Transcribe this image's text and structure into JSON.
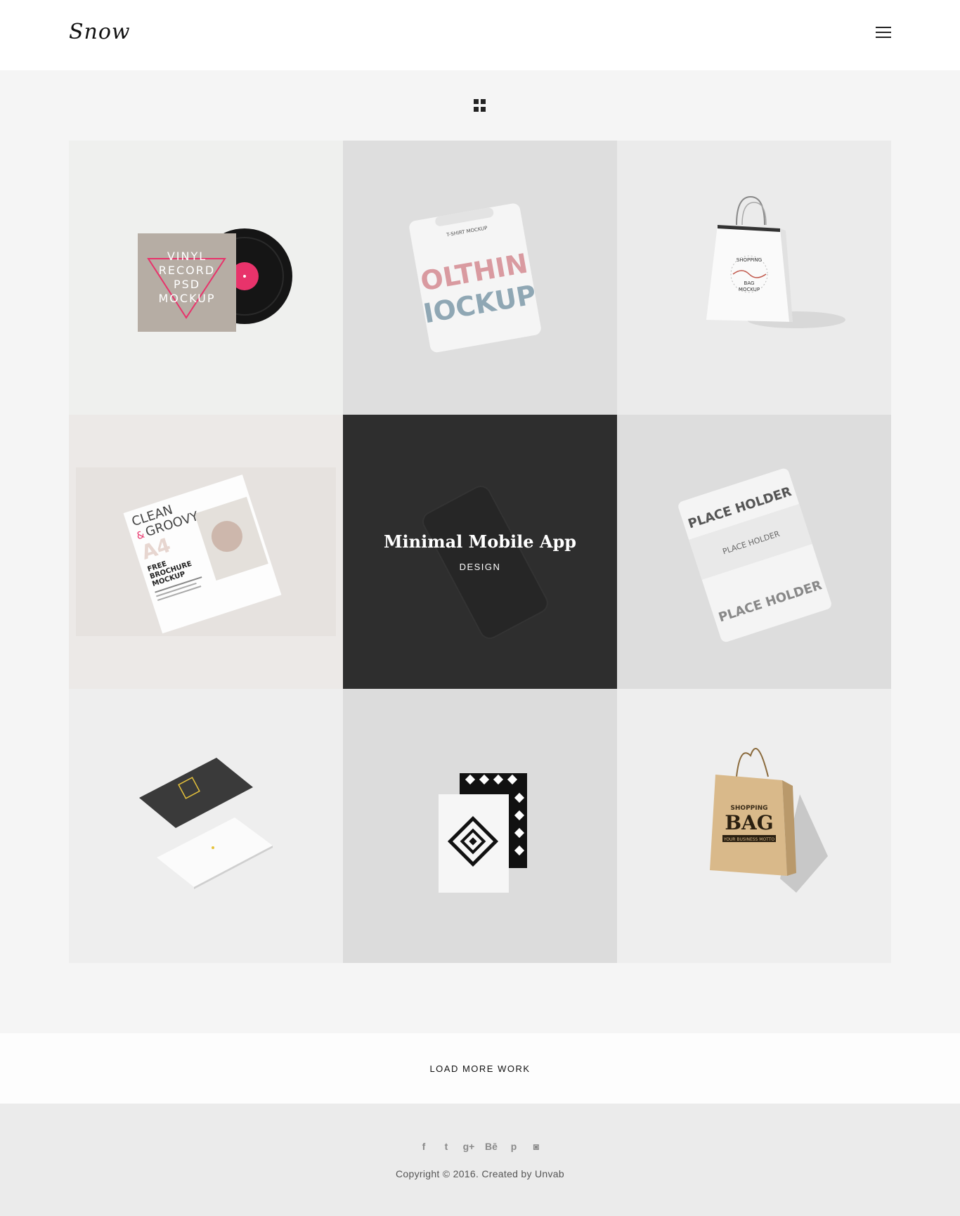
{
  "header": {
    "logo": "Snow",
    "menu_icon": "hamburger-menu-icon"
  },
  "filter": {
    "icon": "grid-filter-icon"
  },
  "colors": {
    "dark_overlay": "#2e2e2e",
    "background": "#f5f5f5",
    "footer_bg": "#ebebeb",
    "accent_pink": "#e8336b"
  },
  "portfolio": {
    "items": [
      {
        "image": "vinyl-record-mockup",
        "bg": "#eff0ee",
        "print": [
          "VINYL",
          "RECORD",
          "PSD",
          "MOCKUP"
        ]
      },
      {
        "image": "tshirt-mockup",
        "bg": "#dedede",
        "print": [
          "OLTHIN",
          "IOCKUP",
          "T-SHIRT MOCKUP"
        ]
      },
      {
        "image": "shopping-bag-white-mockup",
        "bg": "#ebebeb",
        "print": [
          "SHOPPING",
          "BAG",
          "MOCKUP"
        ]
      },
      {
        "image": "brochure-mockup",
        "bg": "#ece9e7",
        "print": [
          "CLEAN",
          "&",
          "GROOVY",
          "A4",
          "FREE",
          "BROCHURE",
          "MOCKUP"
        ]
      },
      {
        "image": "phone-mockup",
        "bg": "#2e2e2e",
        "title": "Minimal Mobile App",
        "category": "DESIGN"
      },
      {
        "image": "tshirt-placeholder-mockup",
        "bg": "#dddddd",
        "print": [
          "PLACE HOLDER",
          "PLACE HOLDER",
          "PLACE HOLDER"
        ]
      },
      {
        "image": "business-card-mockup",
        "bg": "#eeeeee"
      },
      {
        "image": "stationery-pattern-mockup",
        "bg": "#dcdcdc"
      },
      {
        "image": "kraft-bag-mockup",
        "bg": "#eeeeee",
        "print": [
          "SHOPPING",
          "BAG",
          "YOUR BUSINESS MOTTO"
        ]
      }
    ]
  },
  "load_more": {
    "label": "LOAD MORE WORK"
  },
  "footer": {
    "social": [
      {
        "name": "facebook-icon",
        "glyph": "f"
      },
      {
        "name": "twitter-icon",
        "glyph": "t"
      },
      {
        "name": "google-plus-icon",
        "glyph": "g+"
      },
      {
        "name": "behance-icon",
        "glyph": "Bē"
      },
      {
        "name": "pinterest-icon",
        "glyph": "p"
      },
      {
        "name": "instagram-icon",
        "glyph": "◙"
      }
    ],
    "copyright": "Copyright © 2016. Created by Unvab"
  }
}
